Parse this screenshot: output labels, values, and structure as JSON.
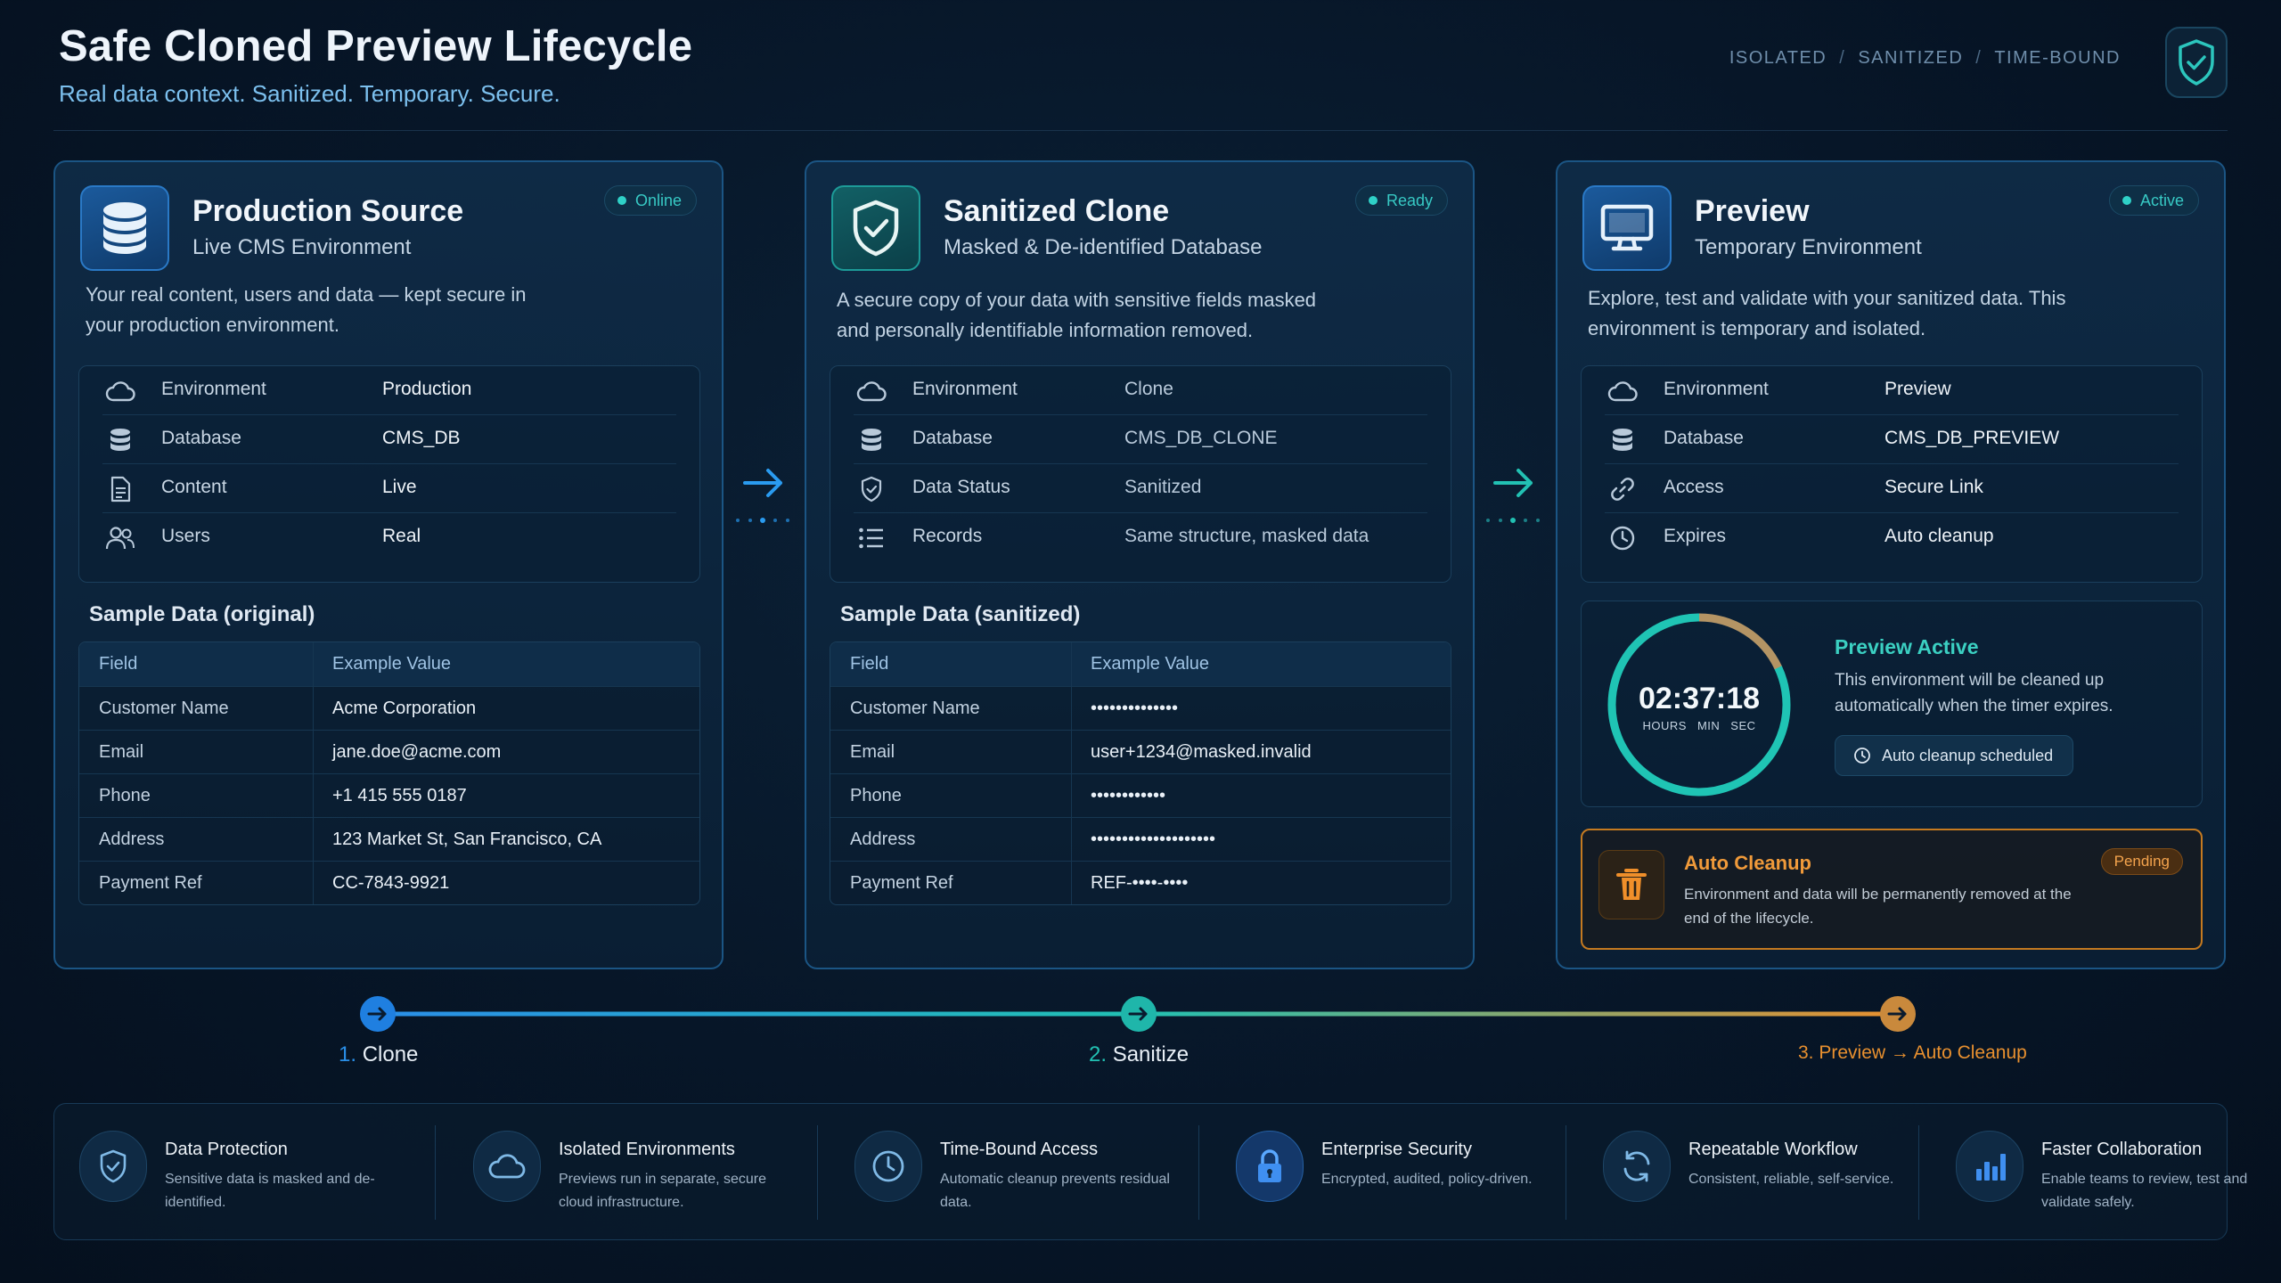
{
  "header": {
    "title": "Safe Cloned Preview Lifecycle",
    "subtitle": "Real data context. Sanitized. Temporary. Secure.",
    "tags": [
      "ISOLATED",
      "SANITIZED",
      "TIME-BOUND"
    ],
    "tag_separator": "/",
    "shield_icon": "shield-check-icon"
  },
  "cards": [
    {
      "title": "Production Source",
      "subtitle": "Live CMS Environment",
      "badge": "Online",
      "icon": "database-icon",
      "description": "Your real content, users and data — kept secure in your production environment.",
      "info": [
        {
          "icon": "cloud-icon",
          "label": "Environment",
          "value": "Production"
        },
        {
          "icon": "database-icon",
          "label": "Database",
          "value": "CMS_DB"
        },
        {
          "icon": "document-icon",
          "label": "Content",
          "value": "Live"
        },
        {
          "icon": "users-icon",
          "label": "Users",
          "value": "Real"
        }
      ],
      "sample_title": "Sample Data (original)",
      "table": {
        "headers": [
          "Field",
          "Example Value"
        ],
        "rows": [
          [
            "Customer Name",
            "Acme Corporation"
          ],
          [
            "Email",
            "jane.doe@acme.com"
          ],
          [
            "Phone",
            "+1 415 555 0187"
          ],
          [
            "Address",
            "123 Market St, San Francisco, CA"
          ],
          [
            "Payment Ref",
            "CC-7843-9921"
          ]
        ]
      }
    },
    {
      "title": "Sanitized Clone",
      "subtitle": "Masked & De-identified Database",
      "badge": "Ready",
      "icon": "shield-check-icon",
      "description": "A secure copy of your data with sensitive fields masked and personally identifiable information removed.",
      "info": [
        {
          "icon": "cloud-icon",
          "label": "Environment",
          "value": "Clone"
        },
        {
          "icon": "database-icon",
          "label": "Database",
          "value": "CMS_DB_CLONE"
        },
        {
          "icon": "shield-icon",
          "label": "Data Status",
          "value": "Sanitized"
        },
        {
          "icon": "list-icon",
          "label": "Records",
          "value": "Same structure, masked data"
        }
      ],
      "sample_title": "Sample Data (sanitized)",
      "table": {
        "headers": [
          "Field",
          "Example Value"
        ],
        "rows": [
          [
            "Customer Name",
            "••••••••••••••"
          ],
          [
            "Email",
            "user+1234@masked.invalid"
          ],
          [
            "Phone",
            "••••••••••••"
          ],
          [
            "Address",
            "••••••••••••••••••••"
          ],
          [
            "Payment Ref",
            "REF-••••-••••"
          ]
        ]
      }
    },
    {
      "title": "Preview",
      "subtitle": "Temporary Environment",
      "badge": "Active",
      "icon": "monitor-icon",
      "description": "Explore, test and validate with your sanitized data. This environment is temporary and isolated.",
      "info": [
        {
          "icon": "cloud-icon",
          "label": "Environment",
          "value": "Preview"
        },
        {
          "icon": "database-icon",
          "label": "Database",
          "value": "CMS_DB_PREVIEW"
        },
        {
          "icon": "link-icon",
          "label": "Access",
          "value": "Secure Link"
        },
        {
          "icon": "clock-icon",
          "label": "Expires",
          "value": "Auto cleanup"
        }
      ],
      "timer": {
        "time": "02:37:18",
        "units": [
          "HOURS",
          "MIN",
          "SEC"
        ],
        "remaining_fraction": 0.82,
        "title": "Preview Active",
        "description": "This environment will be cleaned up automatically when the timer expires.",
        "chip": "Auto cleanup scheduled"
      },
      "cleanup": {
        "title": "Auto Cleanup",
        "description": "Environment and data will be permanently removed at the end of the lifecycle.",
        "badge": "Pending",
        "icon": "trash-icon"
      }
    }
  ],
  "timeline": [
    {
      "num": "1.",
      "label": "Clone",
      "color": "#2a8fe8"
    },
    {
      "num": "2.",
      "label": "Sanitize",
      "color": "#22c1b3"
    },
    {
      "num": "3.",
      "label": "Preview → Auto Cleanup",
      "color": "#e8902f"
    }
  ],
  "features": [
    {
      "icon": "shield-icon",
      "title": "Data Protection",
      "description": "Sensitive data is masked and de-identified."
    },
    {
      "icon": "cloud-icon",
      "title": "Isolated Environments",
      "description": "Previews run in separate, secure cloud infrastructure."
    },
    {
      "icon": "clock-icon",
      "title": "Time-Bound Access",
      "description": "Automatic cleanup prevents residual data."
    },
    {
      "icon": "lock-icon",
      "title": "Enterprise Security",
      "description": "Encrypted, audited, policy-driven."
    },
    {
      "icon": "refresh-icon",
      "title": "Repeatable Workflow",
      "description": "Consistent, reliable, self-service."
    },
    {
      "icon": "bar-chart-icon",
      "title": "Faster Collaboration",
      "description": "Enable teams to review, test and validate safely."
    }
  ],
  "colors": {
    "accent_blue": "#2a8fe8",
    "accent_teal": "#22c1b3",
    "accent_orange": "#e8902f",
    "background": "#071628"
  }
}
